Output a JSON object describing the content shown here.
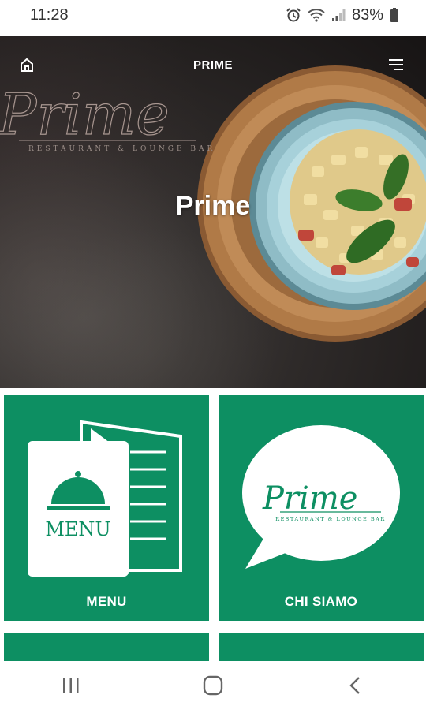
{
  "status_bar": {
    "time": "11:28",
    "battery": "83%"
  },
  "app_bar": {
    "title": "PRIME"
  },
  "hero": {
    "heading": "Prime",
    "logo_script": "Prime",
    "logo_subtitle": "RESTAURANT & LOUNGE BAR"
  },
  "tiles": [
    {
      "label": "MENU",
      "icon_text": "MENU"
    },
    {
      "label": "CHI SIAMO",
      "logo_script": "Prime",
      "logo_subtitle": "RESTAURANT & LOUNGE BAR"
    }
  ],
  "colors": {
    "tile_green": "#0d8f62",
    "white": "#ffffff"
  },
  "icons": [
    "alarm-icon",
    "wifi-icon",
    "signal-icon",
    "battery-icon",
    "home-icon",
    "hamburger-menu-icon",
    "recent-apps-icon",
    "nav-home-icon",
    "back-icon",
    "menu-book-icon",
    "speech-bubble-icon"
  ]
}
